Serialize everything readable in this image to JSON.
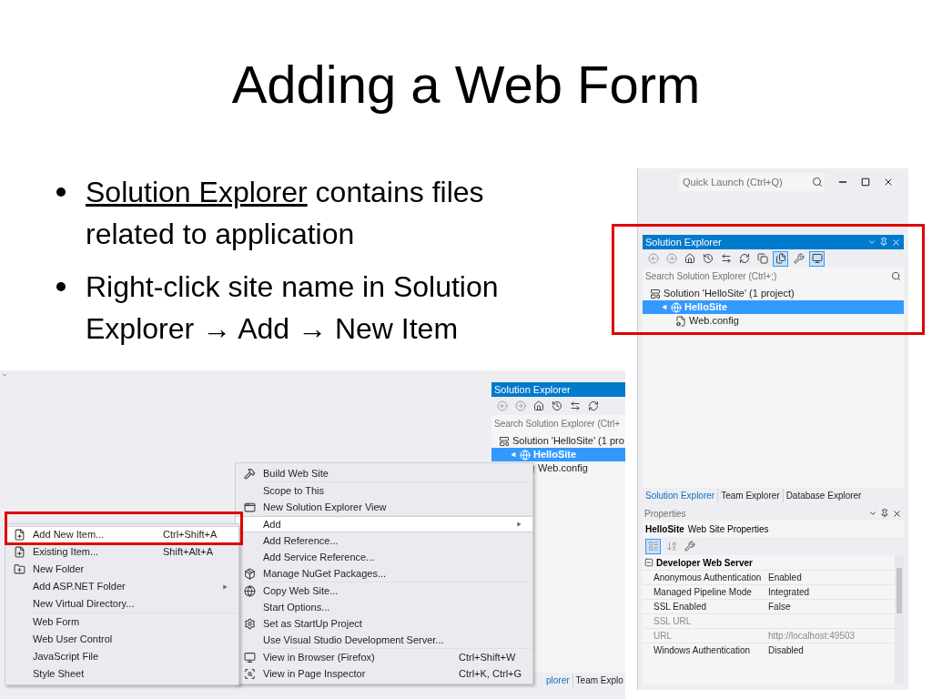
{
  "slide": {
    "title": "Adding a Web Form",
    "bullets": [
      {
        "link": "Solution Explorer",
        "text": "contains files related to application"
      },
      {
        "text": "Right-click site name in Solution Explorer → Add → New Item"
      }
    ]
  },
  "ide_window": {
    "quick_launch": {
      "placeholder": "Quick Launch (Ctrl+Q)"
    },
    "solution_explorer": {
      "title": "Solution Explorer",
      "toolbar": [
        {
          "kind": "back",
          "selected": false
        },
        {
          "kind": "forward",
          "selected": false
        },
        {
          "kind": "home",
          "selected": false
        },
        {
          "kind": "history",
          "selected": false
        },
        {
          "kind": "sync",
          "selected": false
        },
        {
          "kind": "refresh",
          "selected": false
        },
        {
          "kind": "collapse",
          "selected": false
        },
        {
          "kind": "show_all",
          "selected": true
        },
        {
          "kind": "properties",
          "selected": false
        },
        {
          "kind": "preview",
          "selected": true
        }
      ],
      "search": {
        "placeholder": "Search Solution Explorer (Ctrl+;)"
      },
      "tree": [
        {
          "label": "Solution 'HelloSite' (1 project)",
          "kind": "solution",
          "selected": false,
          "children": [
            {
              "label": "HelloSite",
              "kind": "website",
              "selected": true,
              "expanded": true,
              "children": [
                {
                  "label": "Web.config",
                  "kind": "config",
                  "selected": false
                }
              ]
            }
          ]
        }
      ]
    },
    "tool_tabs": [
      {
        "label": "Solution Explorer",
        "selected": true
      },
      {
        "label": "Team Explorer",
        "selected": false
      },
      {
        "label": "Database Explorer",
        "selected": false
      }
    ],
    "properties": {
      "title": "Properties",
      "object": {
        "name": "HelloSite",
        "type": "Web Site Properties"
      },
      "toolbar": [
        {
          "kind": "categorized",
          "selected": true
        },
        {
          "kind": "alphabetical",
          "selected": false
        },
        {
          "kind": "property_pages",
          "selected": false
        }
      ],
      "categories": [
        {
          "name": "Developer Web Server",
          "expanded": true,
          "rows": [
            {
              "name": "Anonymous Authentication",
              "value": "Enabled",
              "disabled": false
            },
            {
              "name": "Managed Pipeline Mode",
              "value": "Integrated",
              "disabled": false
            },
            {
              "name": "SSL Enabled",
              "value": "False",
              "disabled": false
            },
            {
              "name": "SSL URL",
              "value": "",
              "disabled": true
            },
            {
              "name": "URL",
              "value": "http://localhost:49503",
              "disabled": true
            },
            {
              "name": "Windows Authentication",
              "value": "Disabled",
              "disabled": false
            }
          ]
        }
      ]
    }
  },
  "ide_screenshot": {
    "mini_explorer": {
      "title": "Solution Explorer",
      "toolbar": [
        {
          "kind": "back",
          "selected": false
        },
        {
          "kind": "forward",
          "selected": false
        },
        {
          "kind": "home",
          "selected": false
        },
        {
          "kind": "history",
          "selected": false
        },
        {
          "kind": "sync",
          "selected": false
        },
        {
          "kind": "refresh",
          "selected": false
        }
      ],
      "search": {
        "placeholder": "Search Solution Explorer (Ctrl+"
      },
      "tree": [
        {
          "label": "Solution 'HelloSite' (1 pro",
          "kind": "solution",
          "selected": false,
          "children": [
            {
              "label": "HelloSite",
              "kind": "website",
              "selected": true,
              "expanded": true,
              "children": [
                {
                  "label": "Web.config",
                  "kind": "config",
                  "selected": false
                }
              ]
            }
          ]
        }
      ],
      "tabs": [
        {
          "label": "plorer",
          "selected": true
        },
        {
          "label": "Team Explo",
          "selected": false
        }
      ]
    },
    "context_menu": {
      "groups": [
        [
          {
            "label": "Build Web Site",
            "kind": "build",
            "highlighted": false,
            "has_submenu": false
          }
        ],
        [
          {
            "label": "Scope to This",
            "highlighted": false,
            "has_submenu": false
          },
          {
            "label": "New Solution Explorer View",
            "kind": "new_view",
            "highlighted": false,
            "has_submenu": false
          }
        ],
        [
          {
            "label": "Add",
            "highlighted": true,
            "has_submenu": true
          },
          {
            "label": "Add Reference...",
            "highlighted": false,
            "has_submenu": false
          },
          {
            "label": "Add Service Reference...",
            "highlighted": false,
            "has_submenu": false
          },
          {
            "label": "Manage NuGet Packages...",
            "kind": "package",
            "highlighted": false,
            "has_submenu": false
          }
        ],
        [
          {
            "label": "Copy Web Site...",
            "kind": "copy_site",
            "highlighted": false,
            "has_submenu": false
          },
          {
            "label": "Start Options...",
            "highlighted": false,
            "has_submenu": false
          },
          {
            "label": "Set as StartUp Project",
            "kind": "gear",
            "highlighted": false,
            "has_submenu": false
          },
          {
            "label": "Use Visual Studio Development Server...",
            "highlighted": false,
            "has_submenu": false
          }
        ],
        [
          {
            "label": "View in Browser (Firefox)",
            "kind": "browser",
            "shortcut": "Ctrl+Shift+W",
            "highlighted": false,
            "has_submenu": false
          },
          {
            "label": "View in Page Inspector",
            "kind": "inspector",
            "shortcut": "Ctrl+K, Ctrl+G",
            "highlighted": false,
            "has_submenu": false
          }
        ]
      ]
    },
    "add_submenu": {
      "groups": [
        [
          {
            "label": "Add New Item...",
            "kind": "new_item",
            "shortcut": "Ctrl+Shift+A",
            "highlighted": true,
            "has_submenu": false
          },
          {
            "label": "Existing Item...",
            "kind": "existing_item",
            "shortcut": "Shift+Alt+A",
            "highlighted": false,
            "has_submenu": false
          },
          {
            "label": "New Folder",
            "kind": "folder",
            "highlighted": false,
            "has_submenu": false
          },
          {
            "label": "Add ASP.NET Folder",
            "highlighted": false,
            "has_submenu": true
          },
          {
            "label": "New Virtual Directory...",
            "highlighted": false,
            "has_submenu": false
          }
        ],
        [
          {
            "label": "Web Form",
            "highlighted": false,
            "has_submenu": false
          },
          {
            "label": "Web User Control",
            "highlighted": false,
            "has_submenu": false
          },
          {
            "label": "JavaScript File",
            "highlighted": false,
            "has_submenu": false
          },
          {
            "label": "Style Sheet",
            "highlighted": false,
            "has_submenu": false
          }
        ]
      ]
    }
  }
}
